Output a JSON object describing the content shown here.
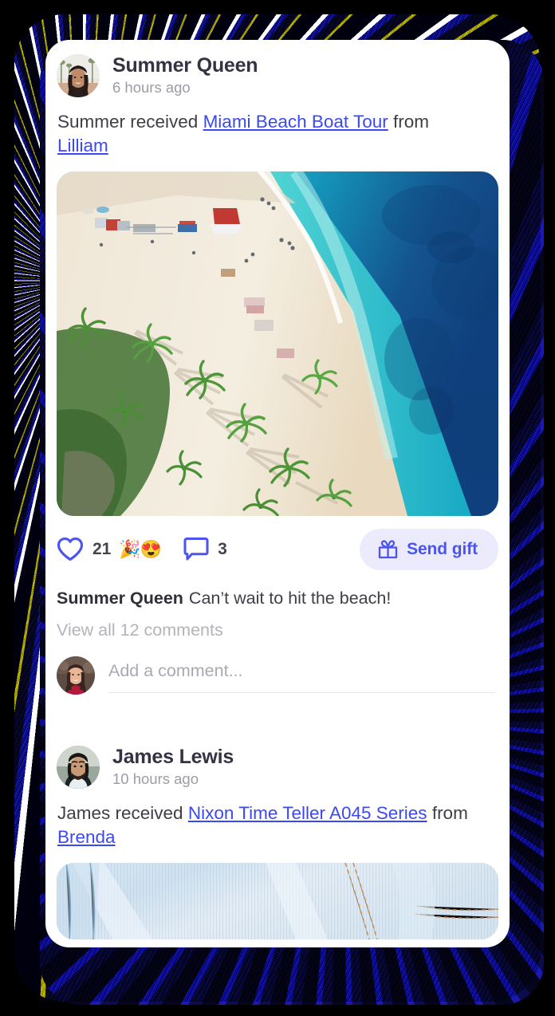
{
  "app": {
    "frame_color": "#13138c",
    "card_background": "#ffffff",
    "accent_color": "#3b49f5",
    "gift_button_bg": "#ecebfd",
    "gift_button_fg": "#4b54f0"
  },
  "feed": {
    "posts": [
      {
        "author": "Summer Queen",
        "timestamp": "6 hours ago",
        "avatar_icon": "avatar-summer-queen",
        "text_prefix": "Summer received ",
        "gift_link": "Miami Beach Boat Tour",
        "text_middle": " from ",
        "sender_link": "Lilliam",
        "media_icon": "aerial-beach-photo",
        "likes": "21",
        "reactions": "🎉😍",
        "comments_count": "3",
        "gift_button_label": "Send gift",
        "comment_author": "Summer Queen",
        "comment_text": "Can’t wait to hit the beach!",
        "view_all_label": "View all 12 comments",
        "comment_placeholder": "Add a comment...",
        "comment_value": "",
        "comment_avatar_icon": "avatar-current-user"
      },
      {
        "author": "James Lewis",
        "timestamp": "10 hours ago",
        "avatar_icon": "avatar-james-lewis",
        "text_prefix": "James received ",
        "gift_link": "Nixon Time Teller A045 Series",
        "text_middle": " from ",
        "sender_link": "Brenda",
        "media_icon": "denim-jeans-photo"
      }
    ]
  },
  "icons": {
    "heart": "heart-icon",
    "comment": "comment-bubble-icon",
    "gift": "gift-icon"
  }
}
